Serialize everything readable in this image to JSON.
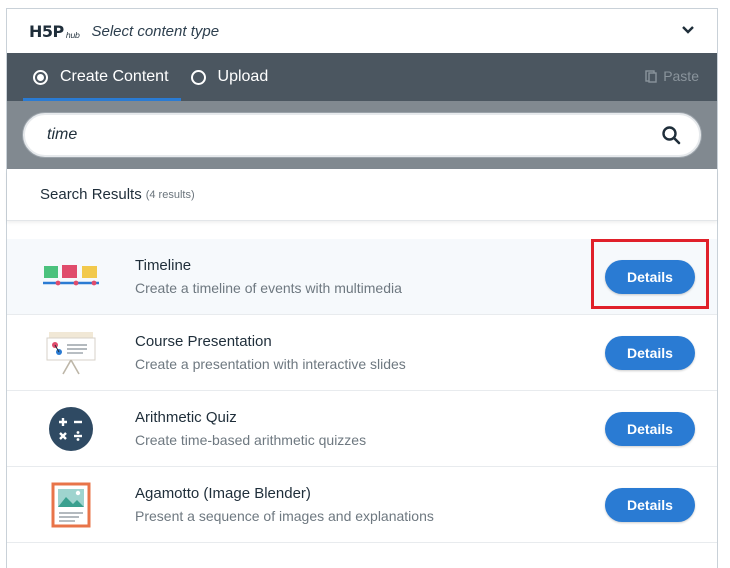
{
  "header": {
    "logo_main": "H5P",
    "logo_sub": "hub",
    "title": "Select content type"
  },
  "tabs": [
    {
      "label": "Create Content",
      "active": true
    },
    {
      "label": "Upload",
      "active": false
    }
  ],
  "paste_label": "Paste",
  "search": {
    "value": "time",
    "placeholder": ""
  },
  "results": {
    "label": "Search Results",
    "count": "(4 results)"
  },
  "items": [
    {
      "title": "Timeline",
      "description": "Create a timeline of events with multimedia",
      "button": "Details",
      "icon": "timeline-icon"
    },
    {
      "title": "Course Presentation",
      "description": "Create a presentation with interactive slides",
      "button": "Details",
      "icon": "course-presentation-icon"
    },
    {
      "title": "Arithmetic Quiz",
      "description": "Create time-based arithmetic quizzes",
      "button": "Details",
      "icon": "arithmetic-quiz-icon"
    },
    {
      "title": "Agamotto (Image Blender)",
      "description": "Present a sequence of images and explanations",
      "button": "Details",
      "icon": "agamotto-icon"
    }
  ],
  "colors": {
    "accent": "#2a7bd3",
    "tabbar": "#4b5660",
    "highlight": "#e0202a"
  }
}
